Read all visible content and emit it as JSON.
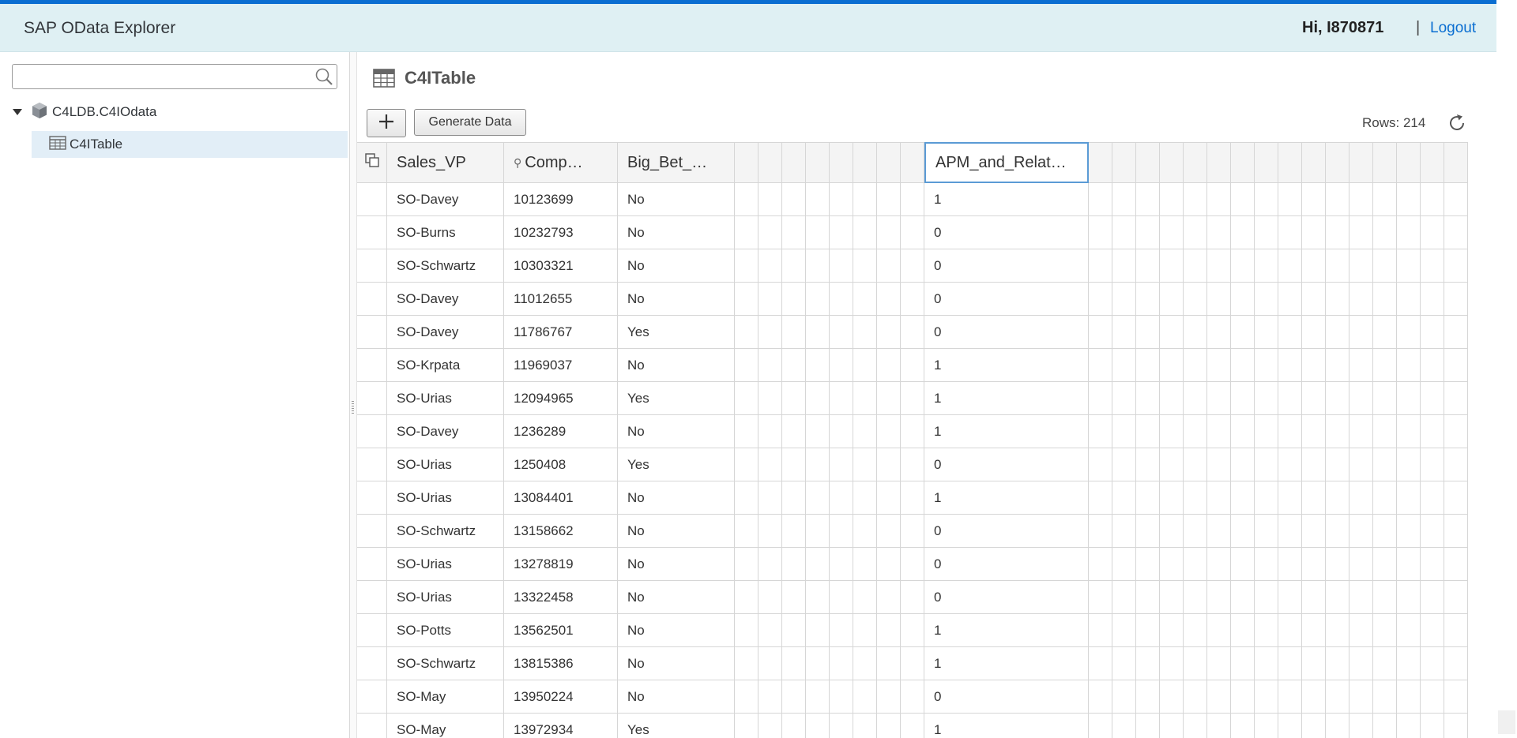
{
  "header": {
    "app_title": "SAP OData Explorer",
    "greeting": "Hi, I870871",
    "separator": "|",
    "logout_label": "Logout"
  },
  "sidebar": {
    "search": {
      "value": "",
      "placeholder": ""
    },
    "tree": {
      "root_label": "C4LDB.C4IOdata",
      "child_label": "C4ITable"
    }
  },
  "main": {
    "table_title": "C4ITable",
    "add_label": "+",
    "generate_label": "Generate Data",
    "rows_label": "Rows: 214"
  },
  "grid": {
    "columns": [
      "Sales_VP",
      "Comp…",
      "Big_Bet_…",
      "",
      "",
      "",
      "",
      "",
      "",
      "",
      "",
      "APM_and_Relat…"
    ],
    "rows": [
      [
        "SO-Davey",
        "10123699",
        "No",
        "1"
      ],
      [
        "SO-Burns",
        "10232793",
        "No",
        "0"
      ],
      [
        "SO-Schwartz",
        "10303321",
        "No",
        "0"
      ],
      [
        "SO-Davey",
        "11012655",
        "No",
        "0"
      ],
      [
        "SO-Davey",
        "11786767",
        "Yes",
        "0"
      ],
      [
        "SO-Krpata",
        "11969037",
        "No",
        "1"
      ],
      [
        "SO-Urias",
        "12094965",
        "Yes",
        "1"
      ],
      [
        "SO-Davey",
        "1236289",
        "No",
        "1"
      ],
      [
        "SO-Urias",
        "1250408",
        "Yes",
        "0"
      ],
      [
        "SO-Urias",
        "13084401",
        "No",
        "1"
      ],
      [
        "SO-Schwartz",
        "13158662",
        "No",
        "0"
      ],
      [
        "SO-Urias",
        "13278819",
        "No",
        "0"
      ],
      [
        "SO-Urias",
        "13322458",
        "No",
        "0"
      ],
      [
        "SO-Potts",
        "13562501",
        "No",
        "1"
      ],
      [
        "SO-Schwartz",
        "13815386",
        "No",
        "1"
      ],
      [
        "SO-May",
        "13950224",
        "No",
        "0"
      ],
      [
        "SO-May",
        "13972934",
        "Yes",
        "1"
      ]
    ]
  },
  "colors": {
    "accent": "#0a6ed1",
    "header_bg": "#dff0f3",
    "selected_node": "#e2eef7"
  }
}
